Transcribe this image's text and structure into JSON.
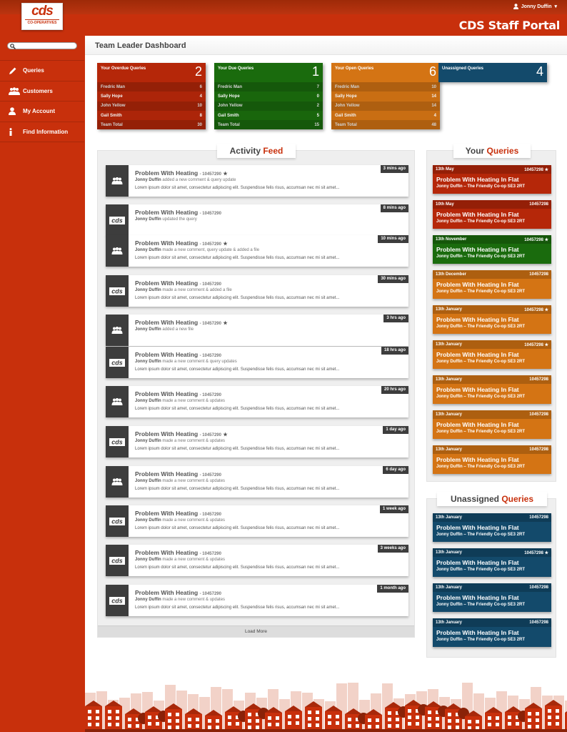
{
  "app": {
    "logo_text": "cds",
    "logo_sub": "CO-OPERATIVES",
    "portal_title": "CDS Staff Portal",
    "user_name": "Jonny Duffin"
  },
  "colors": {
    "brand": "#c8300c",
    "red": "#b52709",
    "green": "#1a6b0d",
    "orange": "#d47414",
    "blue": "#134a6b",
    "dark": "#3d3d3d"
  },
  "sidebar": {
    "search_placeholder": "",
    "items": [
      {
        "label": "Queries",
        "icon": "pencil-icon"
      },
      {
        "label": "Customers",
        "icon": "people-icon"
      },
      {
        "label": "My Account",
        "icon": "person-icon"
      },
      {
        "label": "Find Information",
        "icon": "info-icon"
      }
    ]
  },
  "dashboard": {
    "title": "Team Leader Dashboard",
    "stats": [
      {
        "label": "Your Overdue Queries",
        "count": "2",
        "color": "#b52709",
        "rows": [
          {
            "name": "Fredric Man",
            "value": "6"
          },
          {
            "name": "Sally Hope",
            "value": "4"
          },
          {
            "name": "John Yellow",
            "value": "10"
          },
          {
            "name": "Gail Smith",
            "value": "8"
          },
          {
            "name": "Team Total",
            "value": "30"
          }
        ]
      },
      {
        "label": "Your Due  Queries",
        "count": "1",
        "color": "#1a6b0d",
        "rows": [
          {
            "name": "Fredric Man",
            "value": "7"
          },
          {
            "name": "Sally Hope",
            "value": "0"
          },
          {
            "name": "John Yellow",
            "value": "2"
          },
          {
            "name": "Gail Smith",
            "value": "5"
          },
          {
            "name": "Team Total",
            "value": "15"
          }
        ]
      },
      {
        "label": "Your Open  Queries",
        "count": "6",
        "color": "#d47414",
        "rows": [
          {
            "name": "Fredric Man",
            "value": "10"
          },
          {
            "name": "Sally Hope",
            "value": "14"
          },
          {
            "name": "John Yellow",
            "value": "14"
          },
          {
            "name": "Gail Smith",
            "value": "4"
          },
          {
            "name": "Team Total",
            "value": "48"
          }
        ]
      },
      {
        "label": "Unassigned  Queries",
        "count": "4",
        "color": "#134a6b",
        "rows": []
      }
    ]
  },
  "feed": {
    "title_a": "Activity",
    "title_b": "Feed",
    "load_more": "Load More",
    "items": [
      {
        "icon": "group-icon",
        "title": "Problem With Heating",
        "id": "- 10457290",
        "star": true,
        "user": "Jonny Duffin",
        "action": "added a new comment & query update",
        "body": "Lorem ipsum dolor sit amet, consectetur adipiscing elit. Suspendisse felis risus, accumsan nec mi sit amet...",
        "time": "3 mins ago"
      },
      {
        "icon": "cds-icon",
        "title": "Problem With Heating",
        "id": "- 10457290",
        "star": false,
        "user": "Jonny Duffin",
        "action": "updated the query",
        "body": "",
        "time": "8 mins ago"
      },
      {
        "icon": "group-icon",
        "title": "Problem With Heating",
        "id": "- 10457290",
        "star": true,
        "user": "Jonny Duffin",
        "action": "made a new comment, query update & added a file",
        "body": "Lorem ipsum dolor sit amet, consectetur adipiscing elit. Suspendisse felis risus, accumsan nec mi sit amet...",
        "time": "10 mins ago"
      },
      {
        "icon": "cds-icon",
        "title": "Problem With Heating",
        "id": "- 10457290",
        "star": false,
        "user": "Jonny Duffin",
        "action": "made a new comment & added a file",
        "body": "Lorem ipsum dolor sit amet, consectetur adipiscing elit. Suspendisse felis risus, accumsan nec mi sit amet...",
        "time": "30 mins ago"
      },
      {
        "icon": "group-icon",
        "title": "Problem With Heating",
        "id": "- 10457290",
        "star": true,
        "user": "Jonny Duffin",
        "action": "added a new file",
        "body": "",
        "time": "3 hrs ago"
      },
      {
        "icon": "cds-icon",
        "title": "Problem With Heating",
        "id": "- 10457290",
        "star": false,
        "user": "Jonny Duffin",
        "action": "made a new comment & query updates",
        "body": "Lorem ipsum dolor sit amet, consectetur adipiscing elit. Suspendisse felis risus, accumsan nec mi sit amet...",
        "time": "18 hrs ago"
      },
      {
        "icon": "group-icon",
        "title": "Problem With Heating",
        "id": "- 10457290",
        "star": false,
        "user": "Jonny Duffin",
        "action": "made a new comment & updates",
        "body": "Lorem ipsum dolor sit amet, consectetur adipiscing elit. Suspendisse felis risus, accumsan nec mi sit amet...",
        "time": "20 hrs ago"
      },
      {
        "icon": "cds-icon",
        "title": "Problem With Heating",
        "id": "- 10457290",
        "star": true,
        "user": "Jonny Duffin",
        "action": "made a new comment & updates",
        "body": "Lorem ipsum dolor sit amet, consectetur adipiscing elit. Suspendisse felis risus, accumsan nec mi sit amet...",
        "time": "1 day ago"
      },
      {
        "icon": "group-icon",
        "title": "Problem With Heating",
        "id": "- 10457290",
        "star": false,
        "user": "Jonny Duffin",
        "action": "made a new comment & updates",
        "body": "Lorem ipsum dolor sit amet, consectetur adipiscing elit. Suspendisse felis risus, accumsan nec mi sit amet...",
        "time": "6 day ago"
      },
      {
        "icon": "cds-icon",
        "title": "Problem With Heating",
        "id": "- 10457290",
        "star": false,
        "user": "Jonny Duffin",
        "action": "made a new comment & updates",
        "body": "Lorem ipsum dolor sit amet, consectetur adipiscing elit. Suspendisse felis risus, accumsan nec mi sit amet...",
        "time": "1 week ago"
      },
      {
        "icon": "cds-icon",
        "title": "Problem With Heating",
        "id": "- 10457290",
        "star": false,
        "user": "Jonny Duffin",
        "action": "made a new comment & updates",
        "body": "Lorem ipsum dolor sit amet, consectetur adipiscing elit. Suspendisse felis risus, accumsan nec mi sit amet...",
        "time": "3 weeks ago"
      },
      {
        "icon": "cds-icon",
        "title": "Problem With Heating",
        "id": "- 10457290",
        "star": false,
        "user": "Jonny Duffin",
        "action": "made a new comment & updates",
        "body": "Lorem ipsum dolor sit amet, consectetur adipiscing elit. Suspendisse felis risus, accumsan nec mi sit amet...",
        "time": "1 month ago"
      }
    ]
  },
  "your_queries": {
    "title_a": "Your",
    "title_b": "Queries",
    "items": [
      {
        "date": "13th May",
        "id": "10457298",
        "star": true,
        "title": "Problem With Heating In Flat",
        "sub": "Jonny Duffin  –  The Friendly Co-op  SE3 2RT",
        "color": "#b52709"
      },
      {
        "date": "10th May",
        "id": "10457298",
        "star": false,
        "title": "Problem With Heating In Flat",
        "sub": "Jonny Duffin  –  The Friendly Co-op  SE3 2RT",
        "color": "#b52709"
      },
      {
        "date": "13th November",
        "id": "10457298",
        "star": true,
        "title": "Problem With Heating In Flat",
        "sub": "Jonny Duffin  –  The Friendly Co-op  SE3 2RT",
        "color": "#1a6b0d"
      },
      {
        "date": "13th December",
        "id": "10457298",
        "star": false,
        "title": "Problem With Heating In Flat",
        "sub": "Jonny Duffin  –  The Friendly Co-op  SE3 2RT",
        "color": "#d47414"
      },
      {
        "date": "13th January",
        "id": "10457298",
        "star": true,
        "title": "Problem With Heating In Flat",
        "sub": "Jonny Duffin  –  The Friendly Co-op  SE3 2RT",
        "color": "#d47414"
      },
      {
        "date": "13th January",
        "id": "10457298",
        "star": true,
        "title": "Problem With Heating In Flat",
        "sub": "Jonny Duffin  –  The Friendly Co-op  SE3 2RT",
        "color": "#d47414"
      },
      {
        "date": "13th January",
        "id": "10457298",
        "star": false,
        "title": "Problem With Heating In Flat",
        "sub": "Jonny Duffin  –  The Friendly Co-op  SE3 2RT",
        "color": "#d47414"
      },
      {
        "date": "13th January",
        "id": "10457298",
        "star": false,
        "title": "Problem With Heating In Flat",
        "sub": "Jonny Duffin  –  The Friendly Co-op  SE3 2RT",
        "color": "#d47414"
      },
      {
        "date": "13th January",
        "id": "10457298",
        "star": false,
        "title": "Problem With Heating In Flat",
        "sub": "Jonny Duffin  –  The Friendly Co-op  SE3 2RT",
        "color": "#d47414"
      }
    ]
  },
  "unassigned_queries": {
    "title_a": "Unassigned",
    "title_b": "Queries",
    "items": [
      {
        "date": "13th January",
        "id": "10457298",
        "star": false,
        "title": "Problem With Heating In Flat",
        "sub": "Jonny Duffin  –  The Friendly Co-op  SE3 2RT",
        "color": "#134a6b"
      },
      {
        "date": "13th January",
        "id": "10457298",
        "star": true,
        "title": "Problem With Heating In Flat",
        "sub": "Jonny Duffin  –  The Friendly Co-op  SE3 2RT",
        "color": "#134a6b"
      },
      {
        "date": "13th January",
        "id": "10457298",
        "star": false,
        "title": "Problem With Heating In Flat",
        "sub": "Jonny Duffin  –  The Friendly Co-op  SE3 2RT",
        "color": "#134a6b"
      },
      {
        "date": "13th January",
        "id": "10457298",
        "star": false,
        "title": "Problem With Heating In Flat",
        "sub": "Jonny Duffin  –  The Friendly Co-op  SE3 2RT",
        "color": "#134a6b"
      }
    ]
  }
}
